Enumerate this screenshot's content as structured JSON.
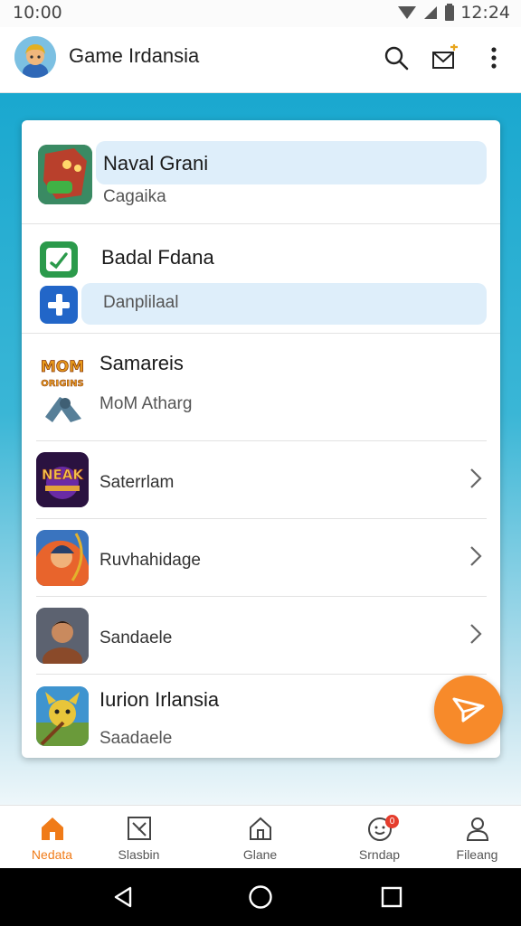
{
  "status": {
    "time_left": "10:00",
    "time_right": "12:24"
  },
  "appbar": {
    "title": "Game Irdansia"
  },
  "list": [
    {
      "title": "Naval Grani",
      "subtitle": "Cagaika"
    },
    {
      "title": "Badal Fdana",
      "subtitle": "Danplilaal"
    },
    {
      "title": "Samareis",
      "subtitle": "MoM Atharg"
    },
    {
      "title": "",
      "subtitle": "Saterrlam"
    },
    {
      "title": "",
      "subtitle": "Ruvhahidage"
    },
    {
      "title": "",
      "subtitle": "Sandaele"
    },
    {
      "title": "Iurion Irlansia",
      "subtitle": "Saadaele"
    }
  ],
  "tile_text": {
    "mom_top": "MOM",
    "mom_bottom": "ORIGINS",
    "neak": "NEAK"
  },
  "bottom_nav": [
    {
      "label": "Nedata",
      "icon": "home-icon",
      "active": true
    },
    {
      "label": "Slasbin",
      "icon": "gallery-icon",
      "active": false
    },
    {
      "label": "Glane",
      "icon": "home-outline-icon",
      "active": false
    },
    {
      "label": "Srndap",
      "icon": "notification-icon",
      "active": false,
      "badge": "0"
    },
    {
      "label": "Fileang",
      "icon": "profile-icon",
      "active": false
    }
  ],
  "colors": {
    "accent": "#f07b18",
    "fab": "#f78a2a",
    "highlight": "#deeefa",
    "background_top": "#1aa8cf"
  }
}
